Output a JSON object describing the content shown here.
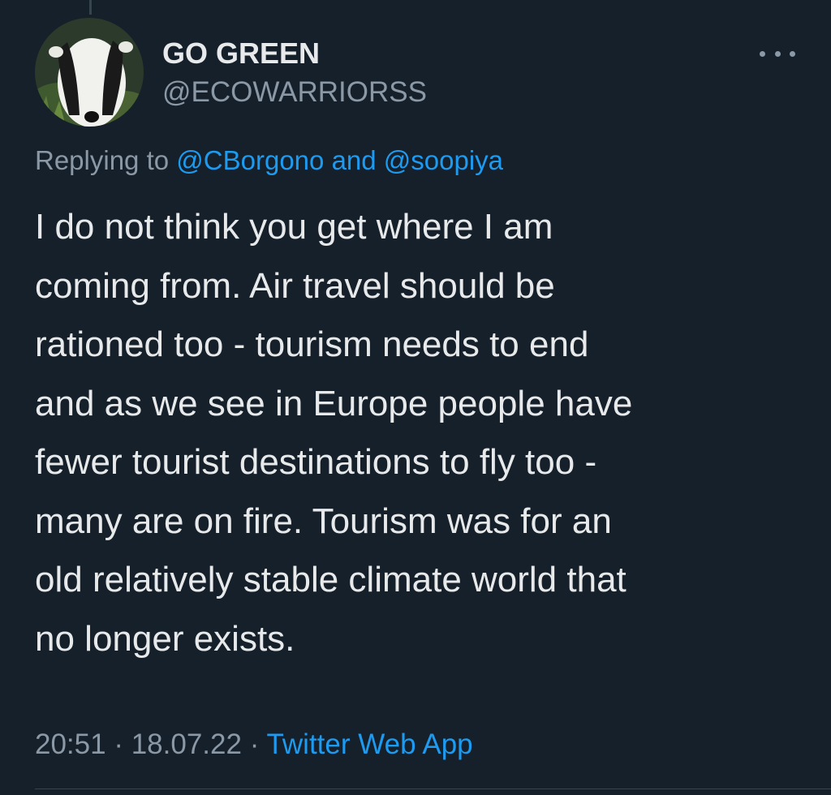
{
  "tweet": {
    "author": {
      "display_name": "GO GREEN",
      "handle": "@ECOWARRIORSS",
      "avatar_icon": "badger-avatar"
    },
    "more_icon": "more-dots-icon",
    "reply": {
      "prefix": "Replying to",
      "mentions": [
        "@CBorgono",
        "@soopiya"
      ],
      "joiner": "and"
    },
    "text_lines": [
      "I do not think you get where I am",
      "coming from. Air travel should be",
      "rationed too - tourism needs to end",
      "and as we see in Europe people have",
      "fewer tourist destinations to fly too -",
      "many are on fire. Tourism was for an",
      "old relatively stable climate world that",
      "no longer exists."
    ],
    "meta": {
      "time": "20:51",
      "date": "18.07.22",
      "separator": "·",
      "source": "Twitter Web App"
    }
  },
  "colors": {
    "background": "#15202b",
    "text_primary": "#e7e9ea",
    "text_secondary": "#8b98a5",
    "link": "#1d9bf0",
    "divider": "#38444d"
  }
}
